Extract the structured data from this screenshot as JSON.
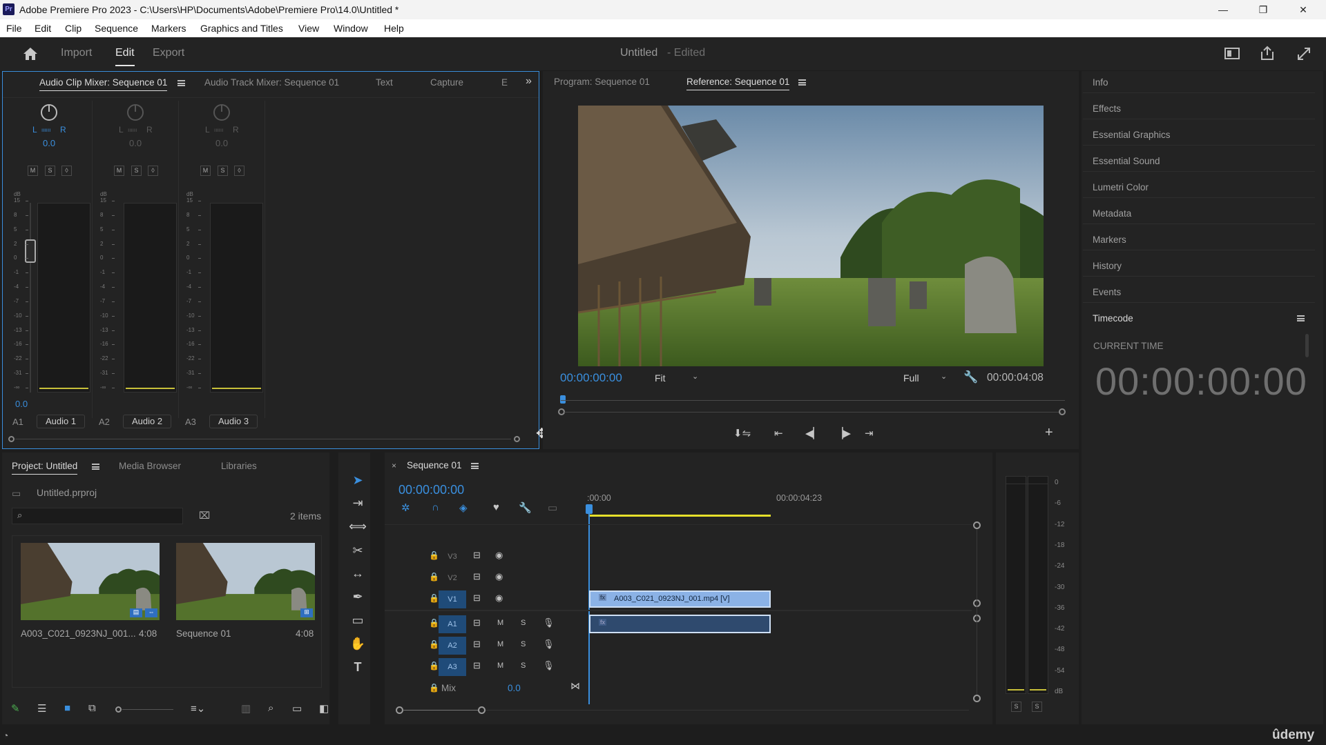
{
  "window": {
    "title": "Adobe Premiere Pro 2023 - C:\\Users\\HP\\Documents\\Adobe\\Premiere Pro\\14.0\\Untitled *",
    "app_icon": "Pr",
    "controls": [
      "—",
      "❐",
      "✕"
    ]
  },
  "menu": [
    "File",
    "Edit",
    "Clip",
    "Sequence",
    "Markers",
    "Graphics and Titles",
    "View",
    "Window",
    "Help"
  ],
  "header": {
    "tabs": [
      "Import",
      "Edit",
      "Export"
    ],
    "active_tab": "Edit",
    "project_title": "Untitled",
    "edited_label": "- Edited"
  },
  "audio_mixer": {
    "tabs": [
      "Audio Clip Mixer: Sequence 01",
      "Audio Track Mixer: Sequence 01",
      "Text",
      "Capture",
      "E"
    ],
    "channels": [
      {
        "pan_l": "L",
        "pan_r": "R",
        "pan_value": "0.0",
        "m": "M",
        "s": "S",
        "r": "◊",
        "db_label": "dB",
        "volume": "0.0",
        "track_id": "A1",
        "track_name": "Audio 1"
      },
      {
        "pan_l": "L",
        "pan_r": "R",
        "pan_value": "0.0",
        "m": "M",
        "s": "S",
        "r": "◊",
        "db_label": "dB",
        "volume": "",
        "track_id": "A2",
        "track_name": "Audio 2"
      },
      {
        "pan_l": "L",
        "pan_r": "R",
        "pan_value": "0.0",
        "m": "M",
        "s": "S",
        "r": "◊",
        "db_label": "dB",
        "volume": "",
        "track_id": "A3",
        "track_name": "Audio 3"
      }
    ],
    "scale": [
      "15",
      "8",
      "5",
      "2",
      "0",
      "-1",
      "-4",
      "-7",
      "-10",
      "-13",
      "-16",
      "-22",
      "-31",
      "-∞"
    ]
  },
  "program_monitor": {
    "tabs": [
      "Program: Sequence 01",
      "Reference: Sequence 01"
    ],
    "active_tab": "Reference: Sequence 01",
    "timecode": "00:00:00:00",
    "fit": "Fit",
    "quality": "Full",
    "duration": "00:00:04:08"
  },
  "right_panel": {
    "items": [
      "Info",
      "Effects",
      "Essential Graphics",
      "Essential Sound",
      "Lumetri Color",
      "Metadata",
      "Markers",
      "History",
      "Events"
    ],
    "timecode_panel": "Timecode",
    "current_time_label": "CURRENT TIME",
    "current_time": "00:00:00:00"
  },
  "project": {
    "tabs": [
      "Project: Untitled",
      "Media Browser",
      "Libraries"
    ],
    "file": "Untitled.prproj",
    "items_count": "2 items",
    "items": [
      {
        "name": "A003_C021_0923NJ_001...",
        "duration": "4:08"
      },
      {
        "name": "Sequence 01",
        "duration": "4:08"
      }
    ]
  },
  "timeline": {
    "tab": "Sequence 01",
    "timecode": "00:00:00:00",
    "ruler": [
      ":00:00",
      "00:00:04:23"
    ],
    "video_tracks": [
      "V3",
      "V2",
      "V1"
    ],
    "audio_tracks": [
      "A1",
      "A2",
      "A3"
    ],
    "mix_label": "Mix",
    "mix_value": "0.0",
    "clip_label": "A003_C021_0923NJ_001.mp4 [V]",
    "clip_fx": "fx",
    "m": "M",
    "s": "S"
  },
  "master_meter": {
    "scale": [
      "0",
      "-6",
      "-12",
      "-18",
      "-24",
      "-30",
      "-36",
      "-42",
      "-48",
      "-54",
      "dB"
    ],
    "solo_left": "S",
    "solo_right": "S"
  },
  "watermark": "ûdemy",
  "colors": {
    "accent_blue": "#3a8fde",
    "clip_video": "#8bb2e6",
    "clip_audio": "#2f4a6e",
    "track_active": "#1f4b79",
    "playhead": "#3a8fde",
    "yellow_bar": "#e6e02a"
  }
}
